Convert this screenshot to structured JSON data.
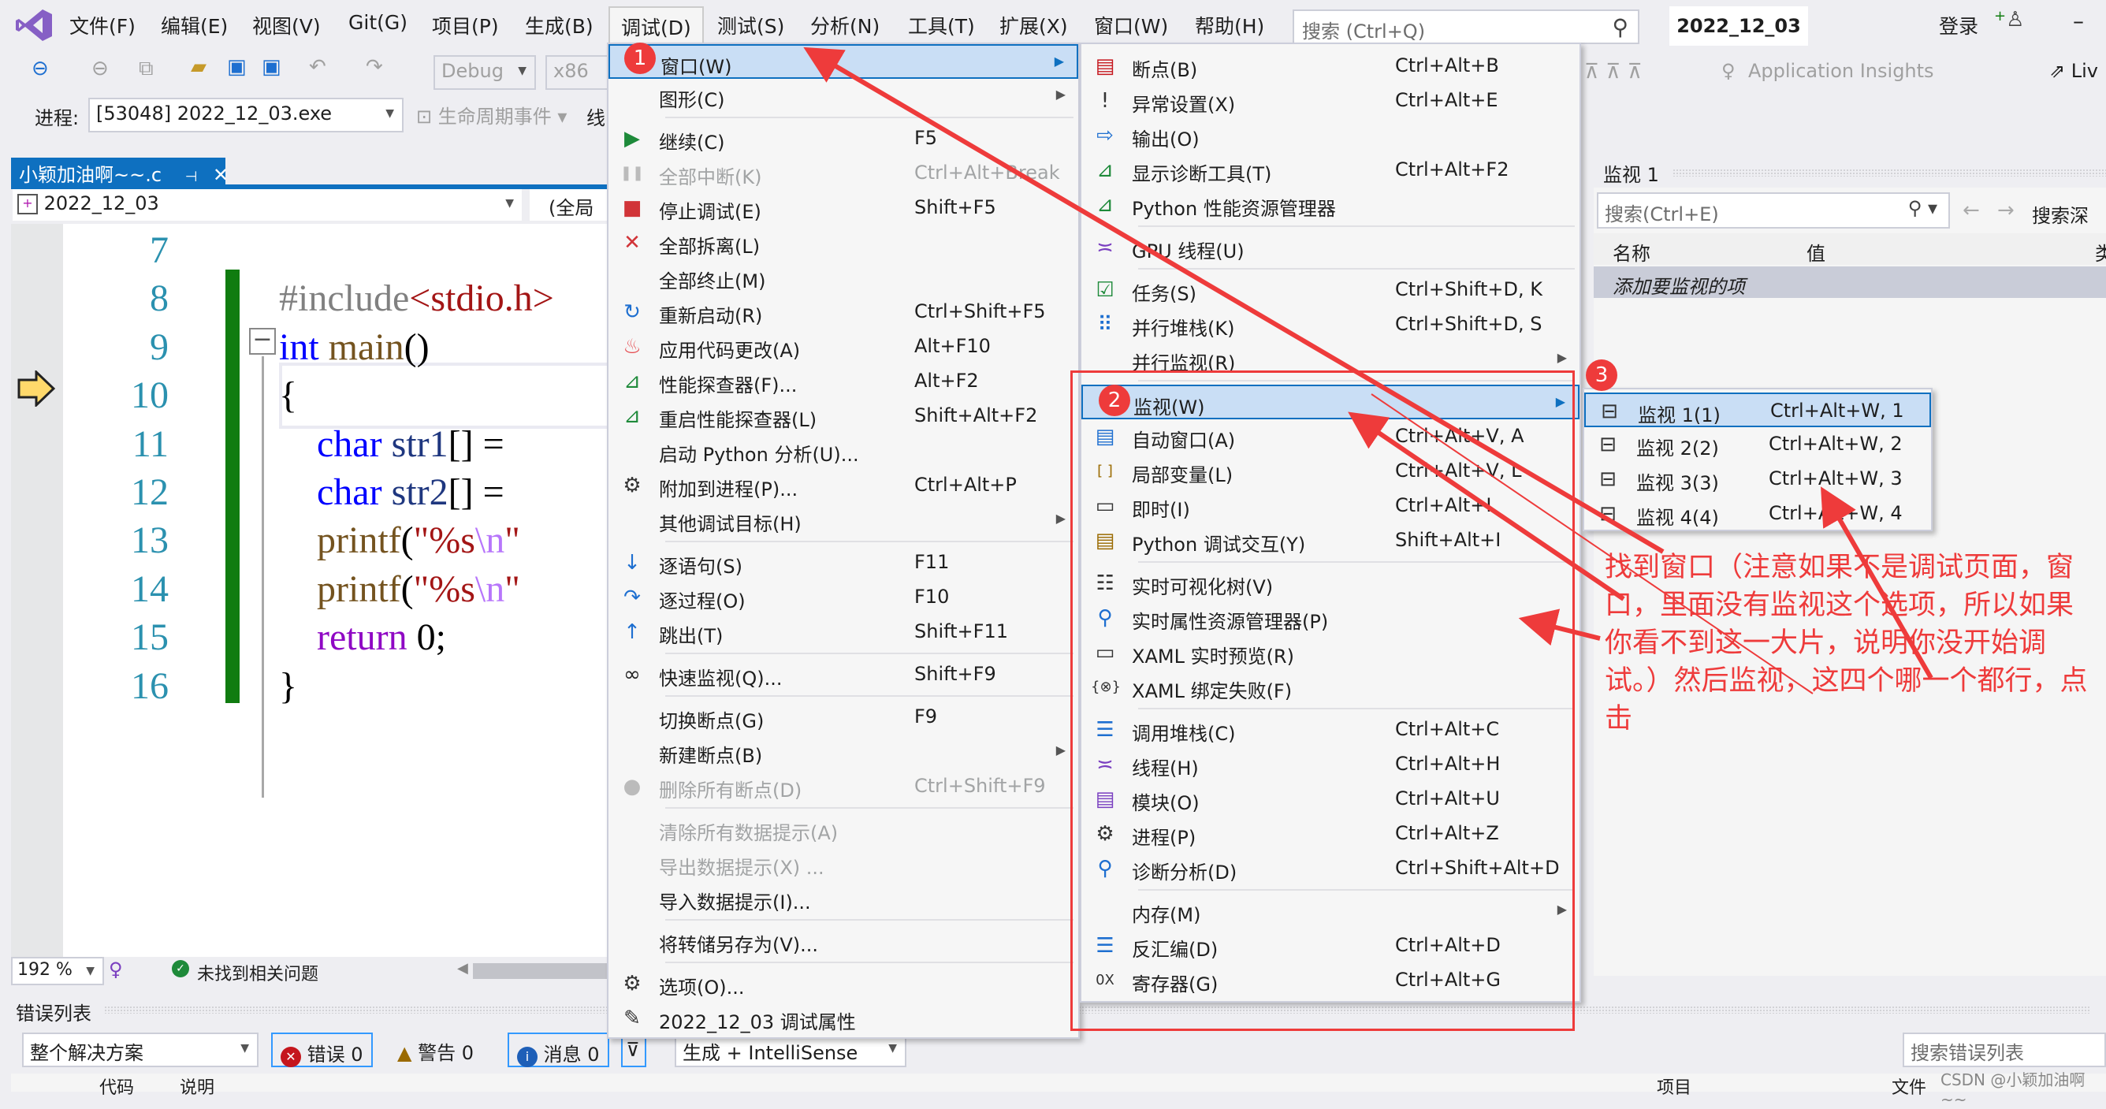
{
  "menubar": {
    "items": [
      "文件(F)",
      "编辑(E)",
      "视图(V)",
      "Git(G)",
      "项目(P)",
      "生成(B)",
      "调试(D)",
      "测试(S)",
      "分析(N)",
      "工具(T)",
      "扩展(X)",
      "窗口(W)",
      "帮助(H)"
    ],
    "active_index": 6,
    "search_placeholder": "搜索 (Ctrl+Q)",
    "project_title": "2022_12_03",
    "login_label": "登录",
    "minimize": "–"
  },
  "toolbar": {
    "config": "Debug",
    "platform": "x86",
    "app_insights": "Application Insights",
    "live_share": "Liv"
  },
  "debug_toolbar": {
    "process_label": "进程:",
    "process_value": "[53048] 2022_12_03.exe",
    "lifecycle_label": "生命周期事件",
    "thread_label": "线"
  },
  "editor": {
    "tab_label": "小颖加油啊~~.c",
    "pin_icon": "⊣",
    "close_icon": "✕",
    "nav_project": "2022_12_03",
    "nav_scope": "(全局",
    "lines": [
      {
        "num": "7",
        "segments": []
      },
      {
        "num": "8",
        "segments": [
          {
            "t": "#include",
            "c": "pp"
          },
          {
            "t": "<stdio.h>",
            "c": "str"
          }
        ]
      },
      {
        "num": "9",
        "segments": [
          {
            "t": "int",
            "c": "kw"
          },
          {
            "t": " ",
            "c": "plain"
          },
          {
            "t": "main",
            "c": "fn"
          },
          {
            "t": "()",
            "c": "plain"
          }
        ]
      },
      {
        "num": "10",
        "segments": [
          {
            "t": "{",
            "c": "plain"
          }
        ]
      },
      {
        "num": "11",
        "segments": [
          {
            "t": "    ",
            "c": "plain"
          },
          {
            "t": "char",
            "c": "kw"
          },
          {
            "t": " ",
            "c": "plain"
          },
          {
            "t": "str1",
            "c": "var"
          },
          {
            "t": "[] =",
            "c": "plain"
          }
        ]
      },
      {
        "num": "12",
        "segments": [
          {
            "t": "    ",
            "c": "plain"
          },
          {
            "t": "char",
            "c": "kw"
          },
          {
            "t": " ",
            "c": "plain"
          },
          {
            "t": "str2",
            "c": "var"
          },
          {
            "t": "[] =",
            "c": "plain"
          }
        ]
      },
      {
        "num": "13",
        "segments": [
          {
            "t": "    ",
            "c": "plain"
          },
          {
            "t": "printf",
            "c": "fn"
          },
          {
            "t": "(",
            "c": "plain"
          },
          {
            "t": "\"%s",
            "c": "str"
          },
          {
            "t": "\\n",
            "c": "esc"
          },
          {
            "t": "\"",
            "c": "str"
          }
        ]
      },
      {
        "num": "14",
        "segments": [
          {
            "t": "    ",
            "c": "plain"
          },
          {
            "t": "printf",
            "c": "fn"
          },
          {
            "t": "(",
            "c": "plain"
          },
          {
            "t": "\"%s",
            "c": "str"
          },
          {
            "t": "\\n",
            "c": "esc"
          },
          {
            "t": "\"",
            "c": "str"
          }
        ]
      },
      {
        "num": "15",
        "segments": [
          {
            "t": "    ",
            "c": "plain"
          },
          {
            "t": "return",
            "c": "ret"
          },
          {
            "t": " 0;",
            "c": "plain"
          }
        ]
      },
      {
        "num": "16",
        "segments": [
          {
            "t": "}",
            "c": "plain"
          }
        ]
      }
    ],
    "current_line": "10",
    "zoom": "192 %",
    "issues_status": "未找到相关问题"
  },
  "debug_menu": {
    "items": [
      {
        "label": "窗口(W)",
        "shortcut": "",
        "submenu": true,
        "icon": "",
        "disabled": false,
        "highlighted": true
      },
      {
        "label": "图形(C)",
        "shortcut": "",
        "submenu": true,
        "icon": "",
        "disabled": false
      },
      {
        "sep": true
      },
      {
        "label": "继续(C)",
        "shortcut": "F5",
        "icon": "play-icon",
        "disabled": false
      },
      {
        "label": "全部中断(K)",
        "shortcut": "Ctrl+Alt+Break",
        "icon": "pause-icon",
        "disabled": true
      },
      {
        "label": "停止调试(E)",
        "shortcut": "Shift+F5",
        "icon": "stop-icon",
        "disabled": false
      },
      {
        "label": "全部拆离(L)",
        "shortcut": "",
        "icon": "detach-x-icon",
        "disabled": false
      },
      {
        "label": "全部终止(M)",
        "shortcut": "",
        "icon": "",
        "disabled": false
      },
      {
        "label": "重新启动(R)",
        "shortcut": "Ctrl+Shift+F5",
        "icon": "restart-icon",
        "disabled": false
      },
      {
        "label": "应用代码更改(A)",
        "shortcut": "Alt+F10",
        "icon": "hot-reload-flame-icon",
        "disabled": false
      },
      {
        "label": "性能探查器(F)...",
        "shortcut": "Alt+F2",
        "icon": "profiler-icon",
        "disabled": false
      },
      {
        "label": "重启性能探查器(L)",
        "shortcut": "Shift+Alt+F2",
        "icon": "profiler-icon",
        "disabled": false
      },
      {
        "label": "启动 Python 分析(U)...",
        "shortcut": "",
        "icon": "",
        "disabled": false
      },
      {
        "label": "附加到进程(P)...",
        "shortcut": "Ctrl+Alt+P",
        "icon": "gears-icon",
        "disabled": false
      },
      {
        "label": "其他调试目标(H)",
        "shortcut": "",
        "submenu": true,
        "icon": "",
        "disabled": false
      },
      {
        "sep": true
      },
      {
        "label": "逐语句(S)",
        "shortcut": "F11",
        "icon": "step-into-icon",
        "disabled": false
      },
      {
        "label": "逐过程(O)",
        "shortcut": "F10",
        "icon": "step-over-icon",
        "disabled": false
      },
      {
        "label": "跳出(T)",
        "shortcut": "Shift+F11",
        "icon": "step-out-icon",
        "disabled": false
      },
      {
        "sep": true
      },
      {
        "label": "快速监视(Q)...",
        "shortcut": "Shift+F9",
        "icon": "glasses-icon",
        "disabled": false
      },
      {
        "sep": true
      },
      {
        "label": "切换断点(G)",
        "shortcut": "F9",
        "icon": "",
        "disabled": false
      },
      {
        "label": "新建断点(B)",
        "shortcut": "",
        "submenu": true,
        "icon": "",
        "disabled": false
      },
      {
        "label": "删除所有断点(D)",
        "shortcut": "Ctrl+Shift+F9",
        "icon": "delete-breakpoints-icon",
        "disabled": true
      },
      {
        "sep": true
      },
      {
        "label": "清除所有数据提示(A)",
        "shortcut": "",
        "icon": "",
        "disabled": true
      },
      {
        "label": "导出数据提示(X) ...",
        "shortcut": "",
        "icon": "",
        "disabled": true
      },
      {
        "label": "导入数据提示(I)...",
        "shortcut": "",
        "icon": "",
        "disabled": false
      },
      {
        "sep": true
      },
      {
        "label": "将转储另存为(V)...",
        "shortcut": "",
        "icon": "",
        "disabled": false
      },
      {
        "sep": true
      },
      {
        "label": "选项(O)...",
        "shortcut": "",
        "icon": "gear-icon",
        "disabled": false
      },
      {
        "label": "2022_12_03 调试属性",
        "shortcut": "",
        "icon": "wrench-icon",
        "disabled": false
      }
    ]
  },
  "windows_menu": {
    "items": [
      {
        "label": "断点(B)",
        "shortcut": "Ctrl+Alt+B",
        "icon": "breakpoints-window-icon"
      },
      {
        "label": "异常设置(X)",
        "shortcut": "Ctrl+Alt+E",
        "icon": "exception-settings-icon"
      },
      {
        "label": "输出(O)",
        "shortcut": "",
        "icon": "output-icon"
      },
      {
        "label": "显示诊断工具(T)",
        "shortcut": "Ctrl+Alt+F2",
        "icon": "diagnostic-tools-icon"
      },
      {
        "label": "Python 性能资源管理器",
        "shortcut": "",
        "icon": "diagnostic-tools-icon"
      },
      {
        "sep": true
      },
      {
        "label": "GPU 线程(U)",
        "shortcut": "",
        "icon": "threads-icon"
      },
      {
        "sep": true
      },
      {
        "label": "任务(S)",
        "shortcut": "Ctrl+Shift+D, K",
        "icon": "tasks-icon"
      },
      {
        "label": "并行堆栈(K)",
        "shortcut": "Ctrl+Shift+D, S",
        "icon": "parallel-stacks-icon"
      },
      {
        "label": "并行监视(R)",
        "shortcut": "",
        "submenu": true,
        "icon": ""
      },
      {
        "sep": true
      },
      {
        "label": "监视(W)",
        "shortcut": "",
        "submenu": true,
        "icon": "",
        "highlighted": true
      },
      {
        "label": "自动窗口(A)",
        "shortcut": "Ctrl+Alt+V, A",
        "icon": "autos-icon"
      },
      {
        "label": "局部变量(L)",
        "shortcut": "Ctrl+Alt+V, L",
        "icon": "locals-icon"
      },
      {
        "label": "即时(I)",
        "shortcut": "Ctrl+Alt+I",
        "icon": "immediate-icon"
      },
      {
        "label": "Python 调试交互(Y)",
        "shortcut": "Shift+Alt+I",
        "icon": "python-interactive-icon"
      },
      {
        "sep": true
      },
      {
        "label": "实时可视化树(V)",
        "shortcut": "",
        "icon": "visual-tree-icon"
      },
      {
        "label": "实时属性资源管理器(P)",
        "shortcut": "",
        "icon": "property-explorer-icon"
      },
      {
        "label": "XAML 实时预览(R)",
        "shortcut": "",
        "icon": "camera-icon"
      },
      {
        "label": "XAML 绑定失败(F)",
        "shortcut": "",
        "icon": "binding-failure-icon"
      },
      {
        "sep": true
      },
      {
        "label": "调用堆栈(C)",
        "shortcut": "Ctrl+Alt+C",
        "icon": "call-stack-icon"
      },
      {
        "label": "线程(H)",
        "shortcut": "Ctrl+Alt+H",
        "icon": "threads-icon"
      },
      {
        "label": "模块(O)",
        "shortcut": "Ctrl+Alt+U",
        "icon": "modules-icon"
      },
      {
        "label": "进程(P)",
        "shortcut": "Ctrl+Alt+Z",
        "icon": "gears-icon"
      },
      {
        "label": "诊断分析(D)",
        "shortcut": "Ctrl+Shift+Alt+D",
        "icon": "diagnostic-analysis-icon"
      },
      {
        "sep": true
      },
      {
        "label": "内存(M)",
        "shortcut": "",
        "submenu": true,
        "icon": ""
      },
      {
        "label": "反汇编(D)",
        "shortcut": "Ctrl+Alt+D",
        "icon": "disassembly-icon"
      },
      {
        "label": "寄存器(G)",
        "shortcut": "Ctrl+Alt+G",
        "icon": "registers-icon"
      }
    ]
  },
  "watch_menu": {
    "items": [
      {
        "label": "监视 1(1)",
        "shortcut": "Ctrl+Alt+W, 1",
        "highlighted": true
      },
      {
        "label": "监视 2(2)",
        "shortcut": "Ctrl+Alt+W, 2"
      },
      {
        "label": "监视 3(3)",
        "shortcut": "Ctrl+Alt+W, 3"
      },
      {
        "label": "监视 4(4)",
        "shortcut": "Ctrl+Alt+W, 4"
      }
    ]
  },
  "watch_panel": {
    "title": "监视 1",
    "search_placeholder": "搜索(Ctrl+E)",
    "search_depth_label": "搜索深度",
    "columns": [
      "名称",
      "值",
      "类"
    ],
    "placeholder_row": "添加要监视的项"
  },
  "error_list": {
    "title": "错误列表",
    "scope": "整个解决方案",
    "errors": "错误 0",
    "warnings": "警告 0",
    "messages": "消息 0",
    "build_filter": "生成 + IntelliSense",
    "search_placeholder": "搜索错误列表",
    "columns": [
      "代码",
      "说明",
      "项目",
      "文件"
    ]
  },
  "annotations": {
    "badges": [
      "1",
      "2",
      "3"
    ],
    "note": "找到窗口（注意如果不是调试页面，窗口，里面没有监视这个选项，所以如果你看不到这一大片，说明你没开始调试。）然后监视，这四个哪一个都行，点击",
    "color": "#ee3b3b"
  },
  "watermark": "CSDN @小颖加油啊~~"
}
